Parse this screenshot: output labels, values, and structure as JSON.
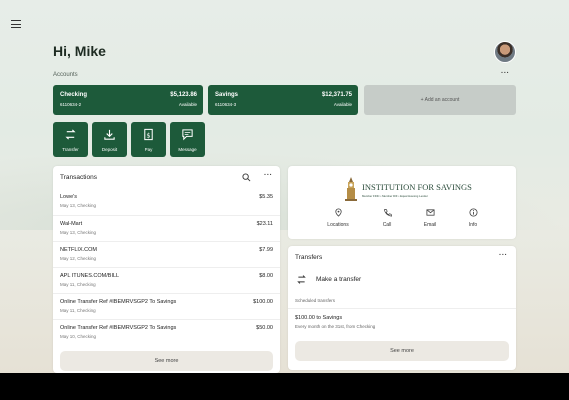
{
  "header": {
    "greeting": "Hi, Mike"
  },
  "accounts_section": {
    "label": "Accounts"
  },
  "accounts": [
    {
      "name": "Checking",
      "number": "6110634-2",
      "balance": "$5,123.86",
      "available_label": "Available"
    },
    {
      "name": "Savings",
      "number": "6110634-3",
      "balance": "$12,371.75",
      "available_label": "Available"
    }
  ],
  "add_account_label": "+ Add an account",
  "quick_actions": [
    {
      "label": "Transfer",
      "icon": "transfer-icon"
    },
    {
      "label": "Deposit",
      "icon": "deposit-icon"
    },
    {
      "label": "Pay",
      "icon": "pay-icon"
    },
    {
      "label": "Message",
      "icon": "message-icon"
    }
  ],
  "transactions": {
    "title": "Transactions",
    "rows": [
      {
        "desc": "Lowe's",
        "sub": "May 13, Checking",
        "amount": "$5.35"
      },
      {
        "desc": "Wal-Mart",
        "sub": "May 13, Checking",
        "amount": "$23.11"
      },
      {
        "desc": "NETFLIX.COM",
        "sub": "May 12, Checking",
        "amount": "$7.99"
      },
      {
        "desc": "APL ITUNES.COM/BILL",
        "sub": "May 11, Checking",
        "amount": "$8.00"
      },
      {
        "desc": "Online Transfer Ref #IBEMRVSGP2 To Savings",
        "sub": "May 11, Checking",
        "amount": "$100.00"
      },
      {
        "desc": "Online Transfer Ref #IBEMRVSGP2 To Savings",
        "sub": "May 10, Checking",
        "amount": "$50.00"
      }
    ],
    "see_more": "See more"
  },
  "institution": {
    "name": "INSTITUTION FOR SAVINGS",
    "tagline": "Member FDIC • Member DIF • Equal Housing Lender",
    "actions": [
      {
        "label": "Locations",
        "icon": "location-pin-icon"
      },
      {
        "label": "Call",
        "icon": "phone-icon"
      },
      {
        "label": "Email",
        "icon": "email-icon"
      },
      {
        "label": "Info",
        "icon": "info-icon"
      }
    ]
  },
  "transfers": {
    "title": "Transfers",
    "make_transfer": "Make a transfer",
    "scheduled_label": "Scheduled transfers",
    "scheduled_item": "$100.00 to Savings",
    "scheduled_detail": "Every month on the 31st, from Checking",
    "see_more": "See more"
  },
  "colors": {
    "brand_green": "#1d5a3a",
    "add_account_bg": "#c6ccc8"
  }
}
